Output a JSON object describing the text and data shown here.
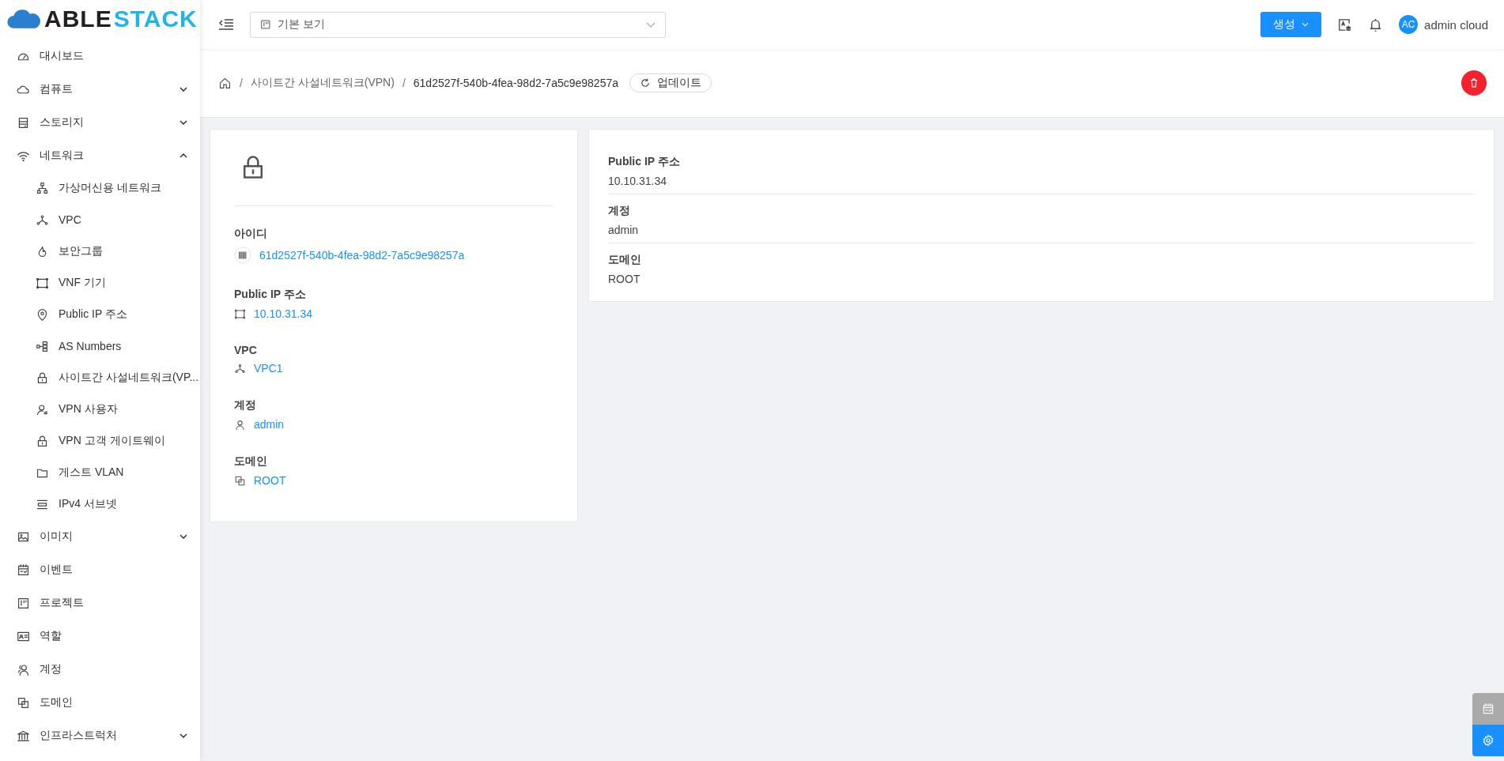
{
  "logo": {
    "part_1": "ABLE",
    "part_2": "STACK"
  },
  "sidebar": {
    "items": [
      {
        "label": "대시보드"
      },
      {
        "label": "컴퓨트",
        "expanded": false
      },
      {
        "label": "스토리지",
        "expanded": false
      },
      {
        "label": "네트워크",
        "expanded": true,
        "children": [
          {
            "label": "가상머신용 네트워크"
          },
          {
            "label": "VPC"
          },
          {
            "label": "보안그룹"
          },
          {
            "label": "VNF 기기"
          },
          {
            "label": "Public IP 주소"
          },
          {
            "label": "AS Numbers"
          },
          {
            "label": "사이트간 사설네트워크(VP..."
          },
          {
            "label": "VPN 사용자"
          },
          {
            "label": "VPN 고객 게이트웨이"
          },
          {
            "label": "게스트 VLAN"
          },
          {
            "label": "IPv4 서브넷"
          }
        ]
      },
      {
        "label": "이미지",
        "expanded": false
      },
      {
        "label": "이벤트"
      },
      {
        "label": "프로젝트"
      },
      {
        "label": "역할"
      },
      {
        "label": "계정"
      },
      {
        "label": "도메인"
      },
      {
        "label": "인프라스트럭처",
        "expanded": false
      }
    ]
  },
  "header": {
    "view_select": {
      "value": "기본 보기"
    },
    "create_button": "생성",
    "user": {
      "initials": "AC",
      "name": "admin cloud"
    }
  },
  "breadcrumb": {
    "separator": "/",
    "items": [
      "사이트간 사설네트워크(VPN)",
      "61d2527f-540b-4fea-98d2-7a5c9e98257a"
    ],
    "refresh_button": "업데이트"
  },
  "detail_card": {
    "fields": [
      {
        "label": "아이디",
        "value": "61d2527f-540b-4fea-98d2-7a5c9e98257a"
      },
      {
        "label": "Public IP 주소",
        "value": "10.10.31.34"
      },
      {
        "label": "VPC",
        "value": "VPC1"
      },
      {
        "label": "계정",
        "value": "admin"
      },
      {
        "label": "도메인",
        "value": "ROOT"
      }
    ]
  },
  "info_card": {
    "fields": [
      {
        "label": "Public IP 주소",
        "value": "10.10.31.34"
      },
      {
        "label": "계정",
        "value": "admin"
      },
      {
        "label": "도메인",
        "value": "ROOT"
      }
    ]
  }
}
